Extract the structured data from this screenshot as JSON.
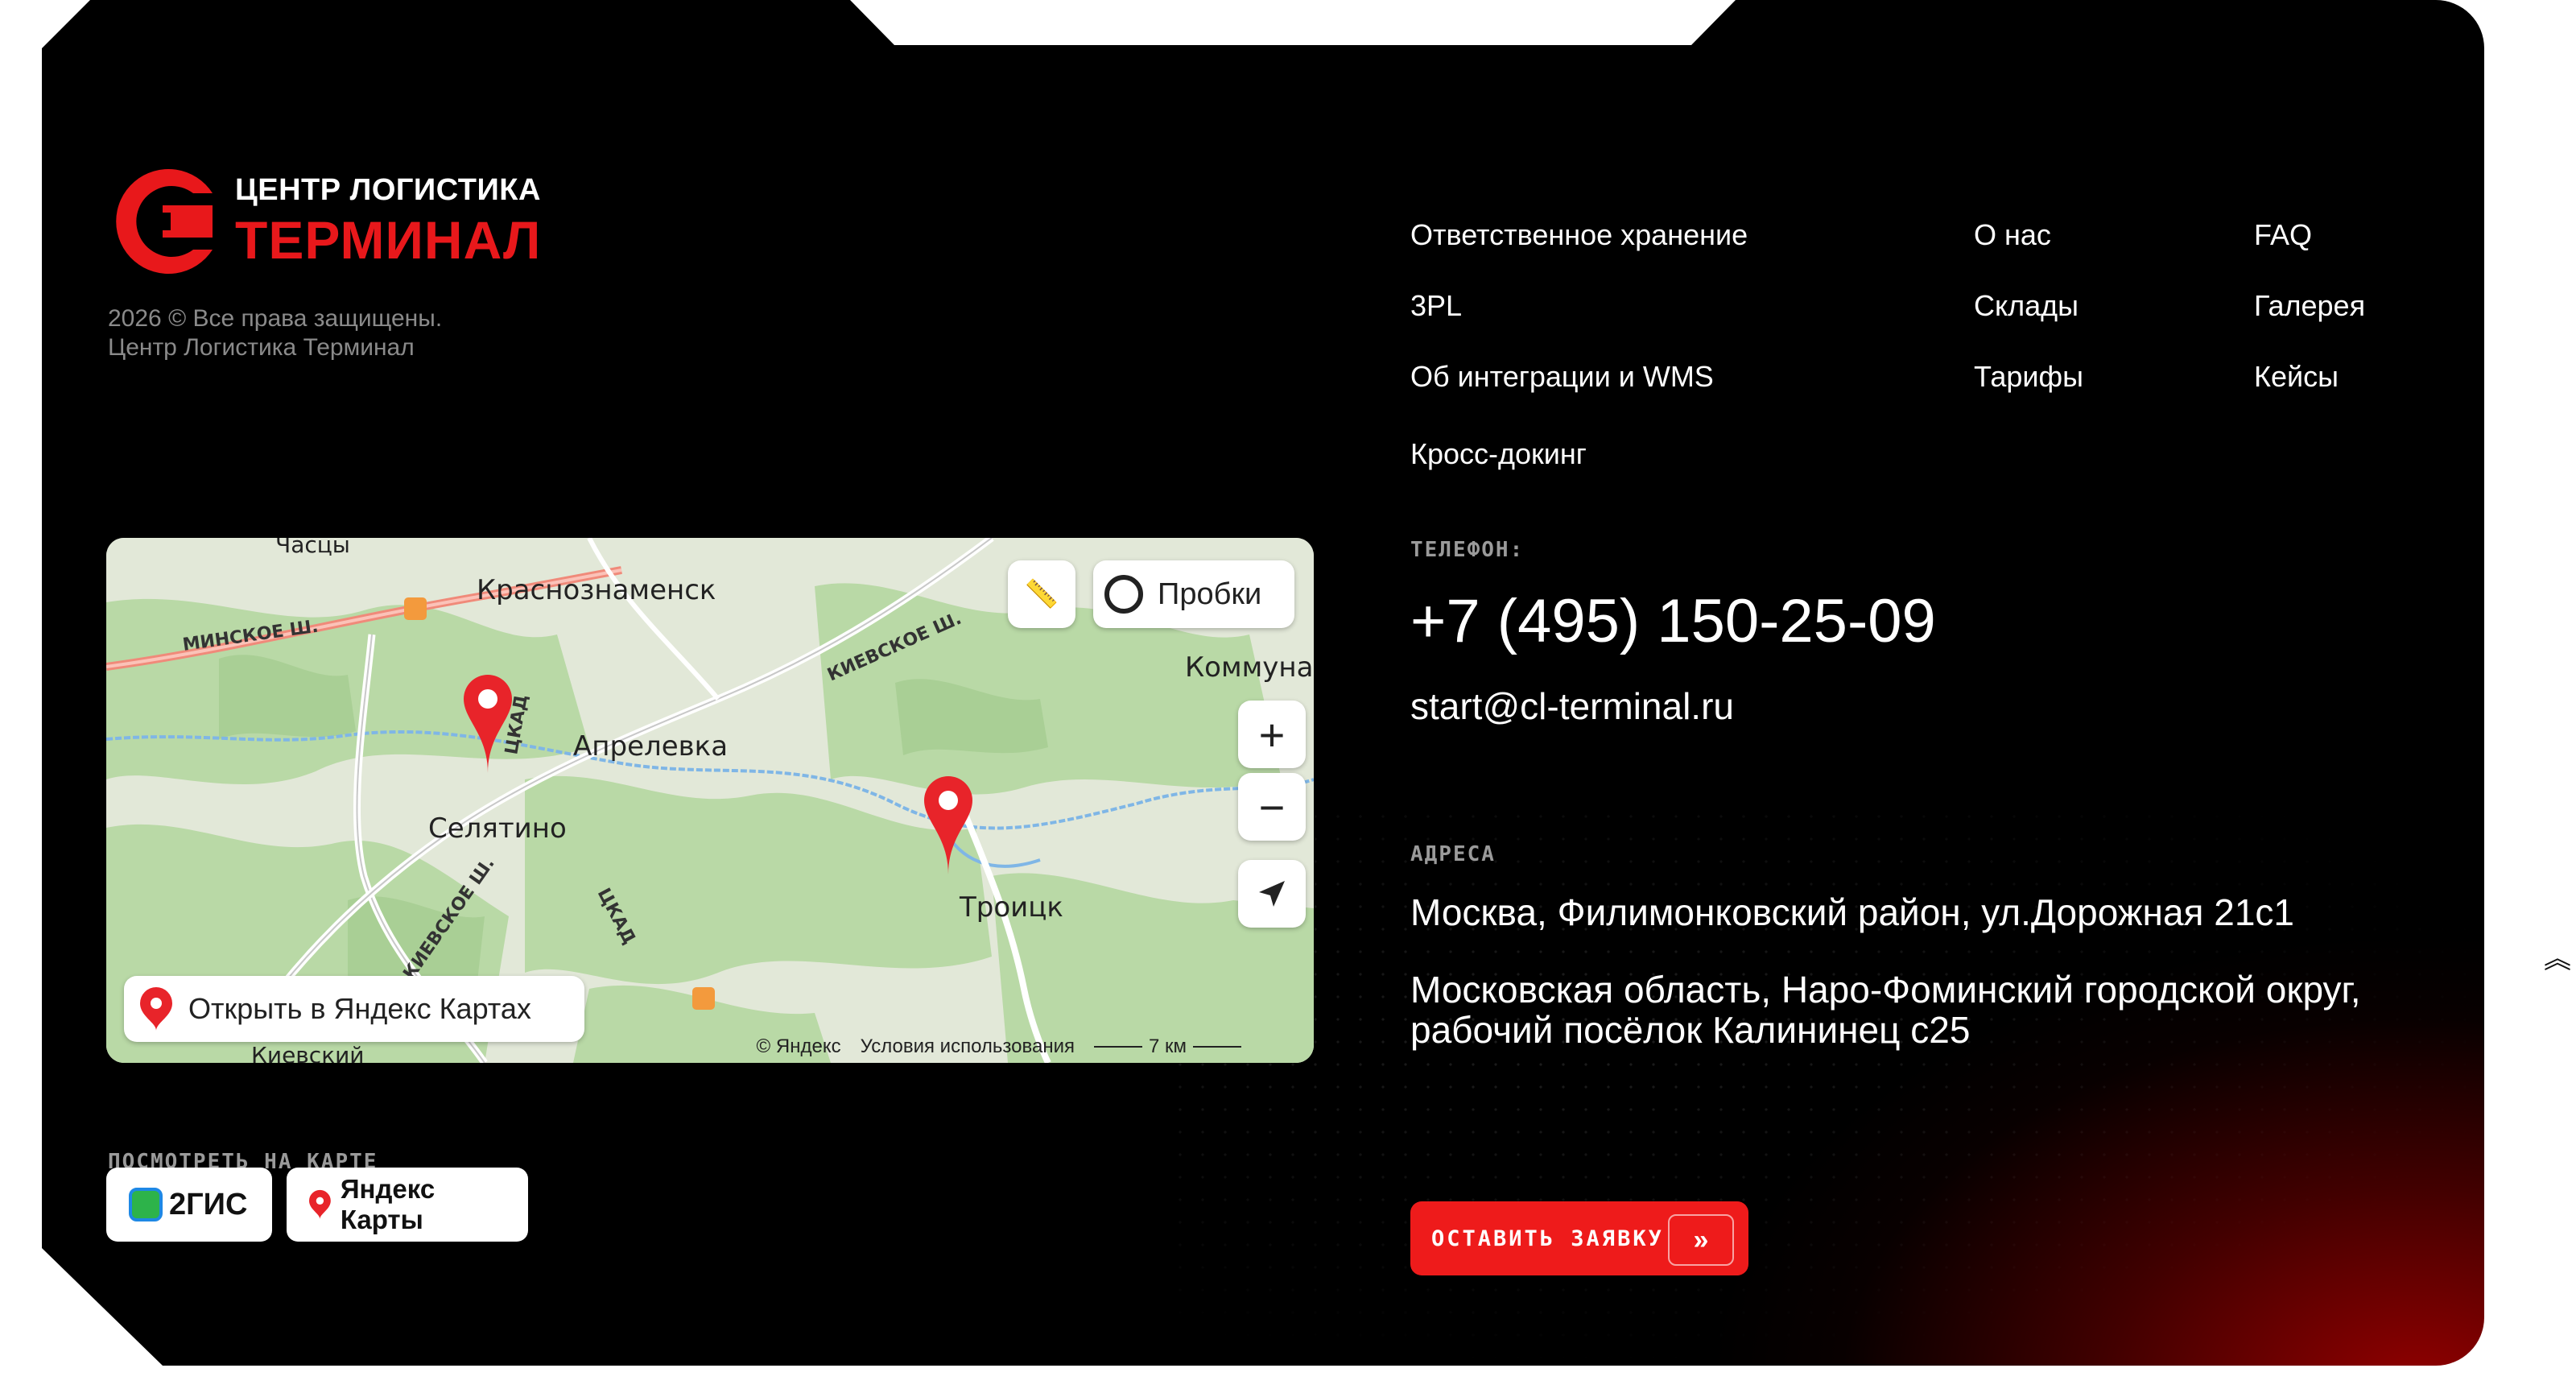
{
  "brand": {
    "line1": "ЦЕНТР ЛОГИСТИКА",
    "line2": "ТЕРМИНАЛ",
    "accent": "#e8181b"
  },
  "copyright": {
    "line1": "2026 © Все права защищены.",
    "line2": "Центр Логистика Терминал"
  },
  "nav": {
    "col1": [
      "Ответственное хранение",
      "3PL",
      "Об интеграции и WMS",
      "Кросс-докинг"
    ],
    "col2": [
      "О нас",
      "Склады",
      "Тарифы"
    ],
    "col3": [
      "FAQ",
      "Галерея",
      "Кейсы"
    ]
  },
  "map": {
    "towns": [
      "Часцы",
      "Краснознаменск",
      "Апрелевка",
      "Селятино",
      "Троицк",
      "Коммуна",
      "Киевский"
    ],
    "roads": [
      "МИНСКОЕ Ш.",
      "КИЕВСКОЕ Ш.",
      "ЦКАД",
      "ЦКАД",
      "КИЕВСКОЕ Ш."
    ],
    "traffic_label": "Пробки",
    "open_label": "Открыть в Яндекс Картах",
    "attribution": "© Яндекс",
    "terms": "Условия использования",
    "scale": "7 км",
    "zoom_in": "+",
    "zoom_out": "−"
  },
  "contacts": {
    "phone_label": "ТЕЛЕФОН:",
    "phone": "+7 (495) 150-25-09",
    "email": "start@cl-terminal.ru",
    "addr_label": "АДРЕСА",
    "addr1": "Москва, Филимонковский район, ул.Дорожная 21с1",
    "addr2": "Московская область, Наро-Фоминский городской округ, рабочий посёлок Калининец с25"
  },
  "view_on_map": {
    "label": "ПОСМОТРЕТЬ НА КАРТЕ",
    "gis": "2ГИС",
    "yandex": "Яндекс Карты"
  },
  "cta": {
    "label": "ОСТАВИТЬ ЗАЯВКУ",
    "arrow": "»"
  },
  "scroll": {
    "arrow": "︽"
  }
}
